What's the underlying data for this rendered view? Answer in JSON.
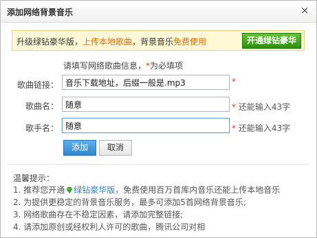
{
  "dialog": {
    "title": "添加网络背景音乐",
    "close_symbol": "×"
  },
  "promo": {
    "prefix": "升级绿钻豪华版，",
    "upload_link": "上传本地歌曲",
    "middle": "，背景音乐",
    "free_text": "免费使用",
    "button_label": "开通绿钻豪华"
  },
  "form": {
    "hint_prefix": "请填写网络歌曲信息，",
    "hint_star": "*",
    "hint_suffix": "为必填项",
    "link_label": "歌曲链接：",
    "link_value": "音乐下载地址，后缀一般是.mp3",
    "name_label": "歌曲名：",
    "name_value": "随意",
    "name_note": "还能输入43字",
    "singer_label": "歌手名：",
    "singer_value": "随意",
    "singer_note": "还能输入43字",
    "required_star": "*",
    "add_label": "添加",
    "cancel_label": "取消"
  },
  "tips": {
    "title": "温馨提示：",
    "line1_prefix": "1. 推荐您开通",
    "line1_link": "绿钻豪华版",
    "line1_suffix": "，免费使用百万首库内音乐还能上传本地音乐",
    "line2": "2. 为提供更稳定的背景音乐服务，最多可添加5首网络背景音乐;",
    "line3": "3. 网络歌曲存在不稳定因素，请添加完整链接;",
    "line4": "4. 请添加原创或经权利人许可的歌曲，腾讯公司对相"
  },
  "colors": {
    "accent_orange": "#e76b00",
    "accent_green": "#2f9c00",
    "required_red": "#e33a1e",
    "link_blue": "#2f7fc6",
    "primary_button": "#2e86cf"
  },
  "icons": {
    "close": "close-icon",
    "diamond": "green-diamond-icon"
  }
}
